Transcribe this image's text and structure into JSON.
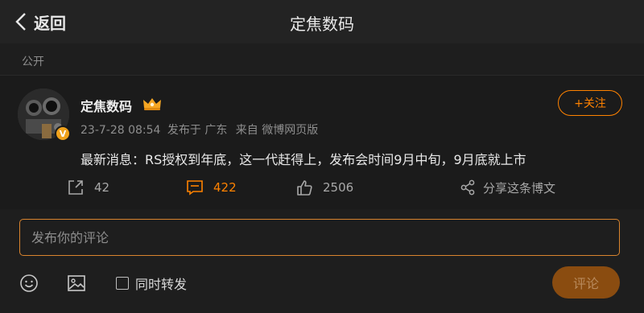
{
  "header": {
    "back_label": "返回",
    "title": "定焦数码"
  },
  "section_label": "公开",
  "post": {
    "username": "定焦数码",
    "date": "23-7-28 08:54",
    "location": "发布于 广东",
    "source": "来自 微博网页版",
    "follow_label": "+关注",
    "content": "最新消息：RS授权到年底，这一代赶得上，发布会时间9月中旬，9月底就上市",
    "verified_badge": "V",
    "actions": {
      "share_count": "42",
      "comment_count": "422",
      "like_count": "2506",
      "share_weibo_label": "分享这条博文"
    }
  },
  "comment": {
    "placeholder": "发布你的评论",
    "repost_label": "同时转发",
    "submit_label": "评论"
  },
  "colors": {
    "accent": "#ff8200",
    "background": "#1e1e1e",
    "submit_disabled": "#8a4c10"
  },
  "icons": [
    "back-chevron-icon",
    "crown-icon",
    "forward-icon",
    "comment-icon",
    "like-icon",
    "share-icon",
    "emoji-icon",
    "image-icon",
    "checkbox-icon"
  ]
}
